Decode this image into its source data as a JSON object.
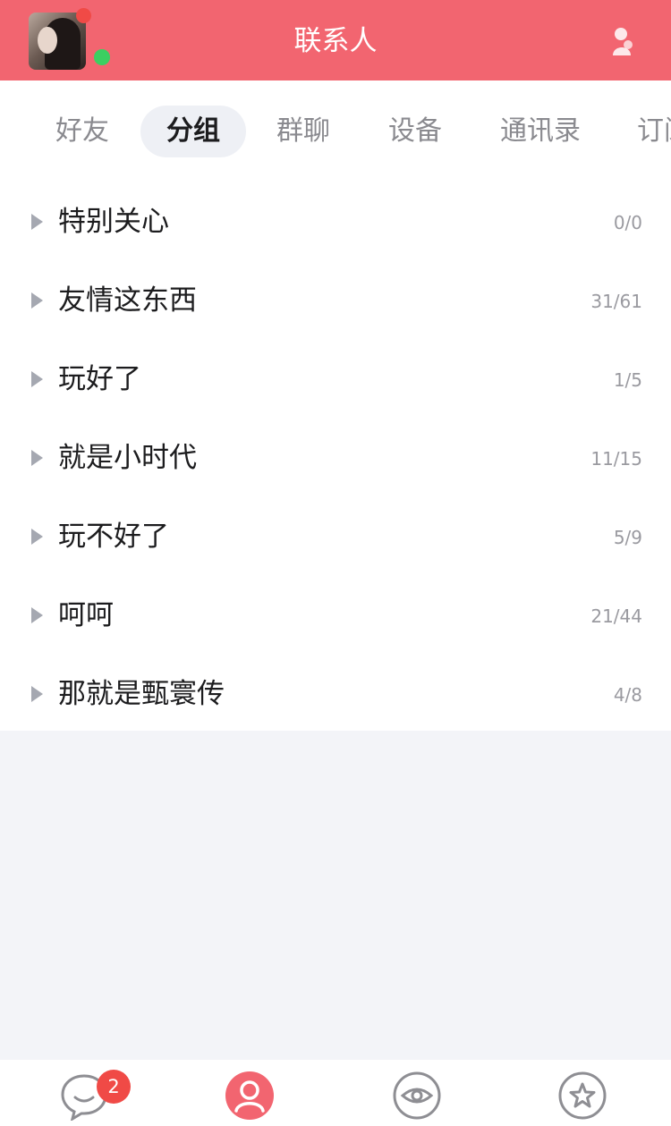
{
  "header": {
    "title": "联系人",
    "avatar": "avatar-photo",
    "right_icon": "profile-icon"
  },
  "tabs": [
    {
      "label": "好友",
      "active": false
    },
    {
      "label": "分组",
      "active": true
    },
    {
      "label": "群聊",
      "active": false
    },
    {
      "label": "设备",
      "active": false
    },
    {
      "label": "通讯录",
      "active": false
    },
    {
      "label": "订阅号",
      "active": false
    }
  ],
  "groups": [
    {
      "name": "特别关心",
      "count": "0/0"
    },
    {
      "name": "友情这东西",
      "count": "31/61"
    },
    {
      "name": "玩好了",
      "count": "1/5"
    },
    {
      "name": "就是小时代",
      "count": "11/15"
    },
    {
      "name": "玩不好了",
      "count": "5/9"
    },
    {
      "name": "呵呵",
      "count": "21/44"
    },
    {
      "name": "那就是甄寰传",
      "count": "4/8"
    }
  ],
  "tabbar": {
    "items": [
      {
        "icon": "message-icon"
      },
      {
        "icon": "contacts-icon",
        "active": true
      },
      {
        "icon": "watch-icon"
      },
      {
        "icon": "star-icon"
      }
    ],
    "message_badge": "2"
  },
  "colors": {
    "header_bg": "#f26570",
    "accent": "#f26570",
    "badge": "#f04a46",
    "online": "#3ccf61"
  }
}
